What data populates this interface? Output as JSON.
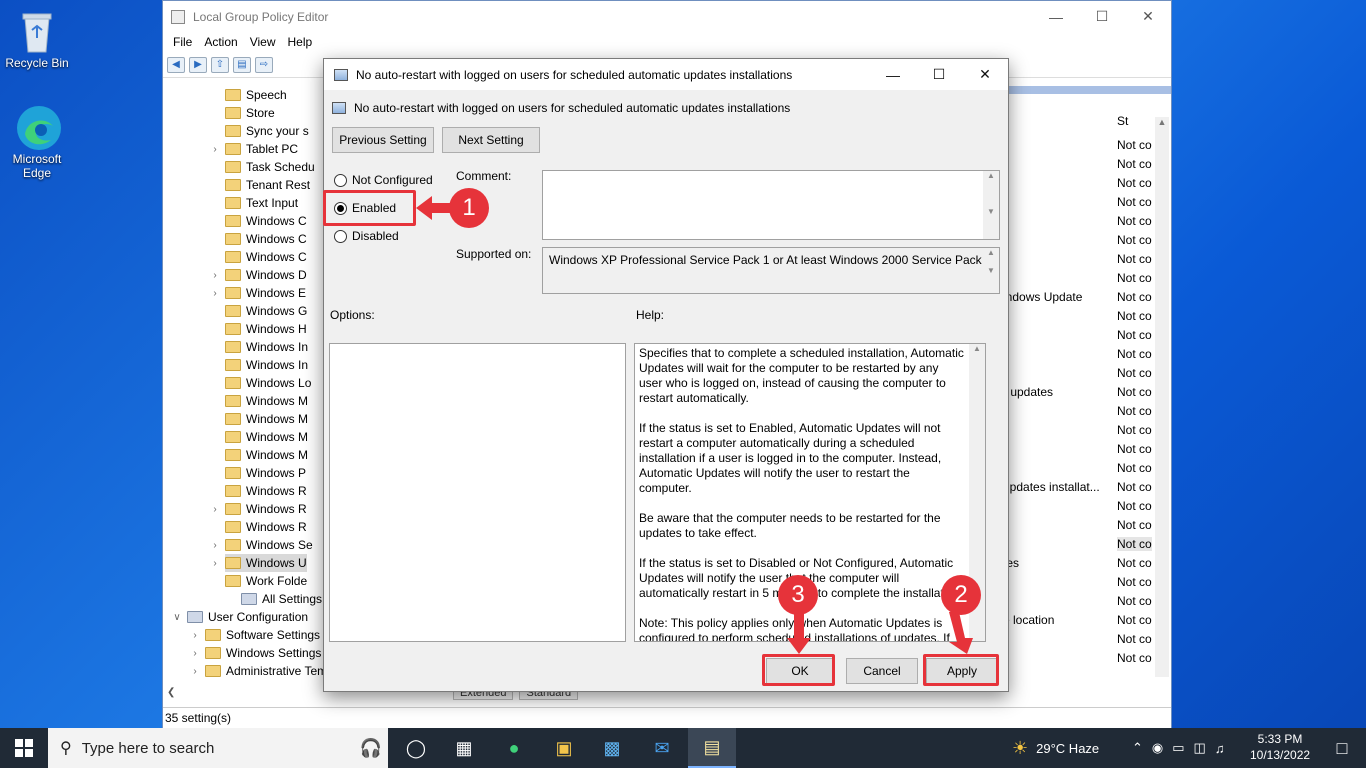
{
  "desktop": {
    "icons": [
      {
        "label": "Recycle Bin"
      },
      {
        "label": "Microsoft Edge"
      }
    ]
  },
  "window": {
    "title": "Local Group Policy Editor",
    "menu": [
      "File",
      "Action",
      "View",
      "Help"
    ],
    "tree": [
      {
        "label": "Speech",
        "expander": false
      },
      {
        "label": "Store",
        "expander": false
      },
      {
        "label": "Sync your s",
        "expander": false
      },
      {
        "label": "Tablet PC",
        "expander": true
      },
      {
        "label": "Task Schedu",
        "expander": false
      },
      {
        "label": "Tenant Rest",
        "expander": false
      },
      {
        "label": "Text Input",
        "expander": false
      },
      {
        "label": "Windows C",
        "expander": false
      },
      {
        "label": "Windows C",
        "expander": false
      },
      {
        "label": "Windows C",
        "expander": false
      },
      {
        "label": "Windows D",
        "expander": true
      },
      {
        "label": "Windows E",
        "expander": true
      },
      {
        "label": "Windows G",
        "expander": false
      },
      {
        "label": "Windows H",
        "expander": false
      },
      {
        "label": "Windows In",
        "expander": false
      },
      {
        "label": "Windows In",
        "expander": false
      },
      {
        "label": "Windows Lo",
        "expander": false
      },
      {
        "label": "Windows M",
        "expander": false
      },
      {
        "label": "Windows M",
        "expander": false
      },
      {
        "label": "Windows M",
        "expander": false
      },
      {
        "label": "Windows M",
        "expander": false
      },
      {
        "label": "Windows P",
        "expander": false
      },
      {
        "label": "Windows R",
        "expander": false
      },
      {
        "label": "Windows R",
        "expander": true
      },
      {
        "label": "Windows R",
        "expander": false
      },
      {
        "label": "Windows Se",
        "expander": true
      },
      {
        "label": "Windows U",
        "expander": true
      },
      {
        "label": "Work Folde",
        "expander": false
      }
    ],
    "tree_bottom": {
      "all_settings": "All Settings",
      "user_config": "User Configuration",
      "software_settings": "Software Settings",
      "windows_settings": "Windows Settings",
      "admin_templates": "Administrative Tem"
    },
    "right_header": "St",
    "state_value": "Not co",
    "right_fragments": [
      "indows Update",
      "r updates",
      "updates installat...",
      "tes",
      "e location"
    ],
    "bottom_tabs": [
      "Extended",
      "Standard"
    ],
    "status": "35 setting(s)"
  },
  "dialog": {
    "title": "No auto-restart with logged on users for scheduled automatic updates installations",
    "heading": "No auto-restart with logged on users for scheduled automatic updates installations",
    "prev_button": "Previous Setting",
    "next_button": "Next Setting",
    "options": {
      "not_configured": "Not Configured",
      "enabled": "Enabled",
      "disabled": "Disabled",
      "selected": "enabled"
    },
    "comment_label": "Comment:",
    "supported_label": "Supported on:",
    "supported_value": "Windows XP Professional Service Pack 1 or At least Windows 2000 Service Pack 3",
    "options_label": "Options:",
    "help_label": "Help:",
    "help_paragraphs": [
      "Specifies that to complete a scheduled installation, Automatic Updates will wait for the computer to be restarted by any user who is logged on, instead of causing the computer to restart automatically.",
      "If the status is set to Enabled, Automatic Updates will not restart a computer automatically during a scheduled installation if a user is logged in to the computer. Instead, Automatic Updates will notify the user to restart the computer.",
      "Be aware that the computer needs to be restarted for the updates to take effect.",
      "If the status is set to Disabled or Not Configured, Automatic Updates will notify the user that the computer will automatically restart in 5 minutes to complete the installation.",
      "Note: This policy applies only when Automatic Updates is configured to perform scheduled installations of updates. If the \"Configure Automatic Updates\" policy is disabled, this policy has"
    ],
    "ok": "OK",
    "cancel": "Cancel",
    "apply": "Apply"
  },
  "annotations": {
    "step1": "1",
    "step2": "2",
    "step3": "3",
    "color": "#e6333a"
  },
  "taskbar": {
    "search_placeholder": "Type here to search",
    "weather": "29°C  Haze",
    "time": "5:33 PM",
    "date": "10/13/2022"
  }
}
